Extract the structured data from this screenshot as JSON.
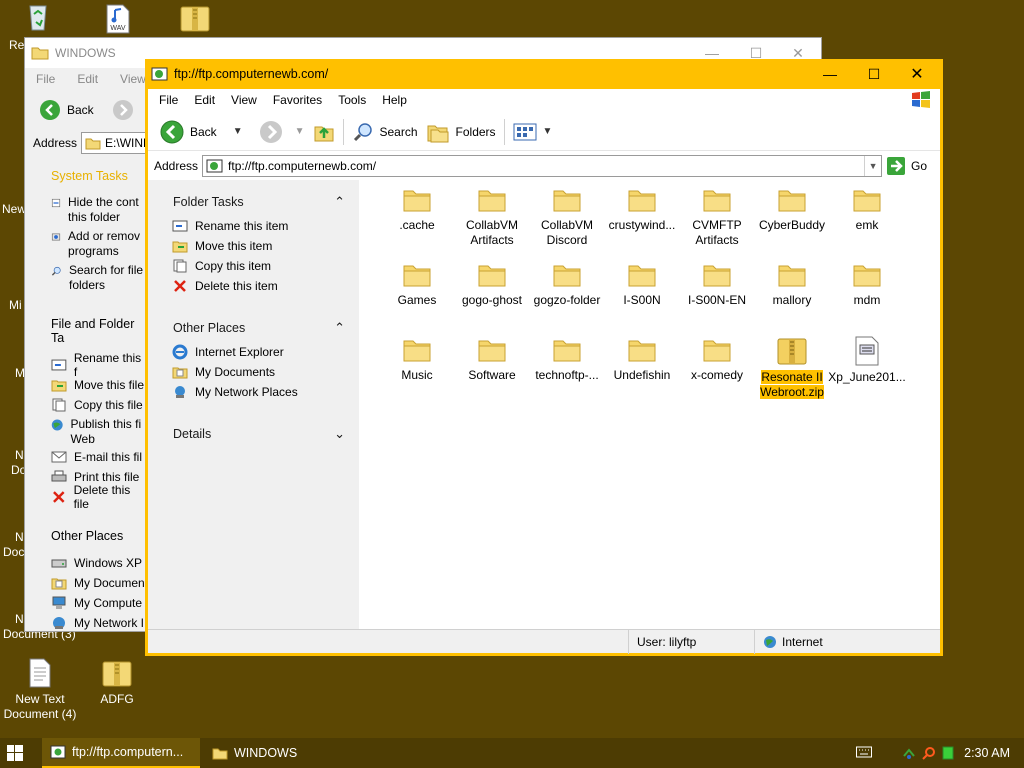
{
  "desktop": {
    "icons": [
      {
        "name": "recycle-bin",
        "label": ""
      },
      {
        "name": "wav-file",
        "label": ""
      },
      {
        "name": "zip-file",
        "label": ""
      },
      {
        "label": "New Text Document (4)"
      },
      {
        "label": "ADFG"
      }
    ],
    "edge_labels": [
      "Re",
      "New",
      "Mi",
      "M",
      "N",
      "Do",
      "N",
      "Doc",
      "N",
      "Document (3)"
    ]
  },
  "back_window": {
    "title": "WINDOWS",
    "menu": [
      "File",
      "Edit",
      "View"
    ],
    "back_label": "Back",
    "address_label": "Address",
    "address_value": "E:\\WIND",
    "system_tasks_heading": "System Tasks",
    "system_tasks": [
      "Hide the cont this folder",
      "Add or remov programs",
      "Search for file folders"
    ],
    "file_tasks_heading": "File and Folder Ta",
    "file_tasks": [
      "Rename this f",
      "Move this file",
      "Copy this file",
      "Publish this fi Web",
      "E-mail this fil",
      "Print this file",
      "Delete this file"
    ],
    "other_places_heading": "Other Places",
    "other_places": [
      "Windows XP",
      "My Documen",
      "My Compute",
      "My Network I"
    ]
  },
  "front_window": {
    "title": "ftp://ftp.computernewb.com/",
    "menu": [
      "File",
      "Edit",
      "View",
      "Favorites",
      "Tools",
      "Help"
    ],
    "toolbar": {
      "back": "Back",
      "search": "Search",
      "folders": "Folders"
    },
    "address_label": "Address",
    "address_value": "ftp://ftp.computernewb.com/",
    "go_label": "Go",
    "sidebar": {
      "folder_tasks_heading": "Folder Tasks",
      "folder_tasks": [
        "Rename this item",
        "Move this item",
        "Copy this item",
        "Delete this item"
      ],
      "other_places_heading": "Other Places",
      "other_places": [
        "Internet Explorer",
        "My Documents",
        "My Network Places"
      ],
      "details_heading": "Details"
    },
    "files": [
      ".cache",
      "CollabVM Artifacts",
      "CollabVM Discord",
      "crustywind...",
      "CVMFTP Artifacts",
      "CyberBuddy",
      "emk",
      "Games",
      "gogo-ghost",
      "gogzo-folder",
      "I-S00N",
      "I-S00N-EN",
      "mallory",
      "mdm",
      "Music",
      "Software",
      "technoftp-...",
      "Undefishin",
      "x-comedy",
      "Resonate II Webroot.zip",
      "Xp_June201..."
    ],
    "status": {
      "user": "User: lilyftp",
      "zone": "Internet"
    }
  },
  "taskbar": {
    "tasks": [
      "ftp://ftp.computern...",
      "WINDOWS"
    ],
    "clock": "2:30 AM"
  },
  "colors": {
    "accent": "#ffc000",
    "desktop": "#5c4703",
    "taskbar": "#4d3c03"
  }
}
